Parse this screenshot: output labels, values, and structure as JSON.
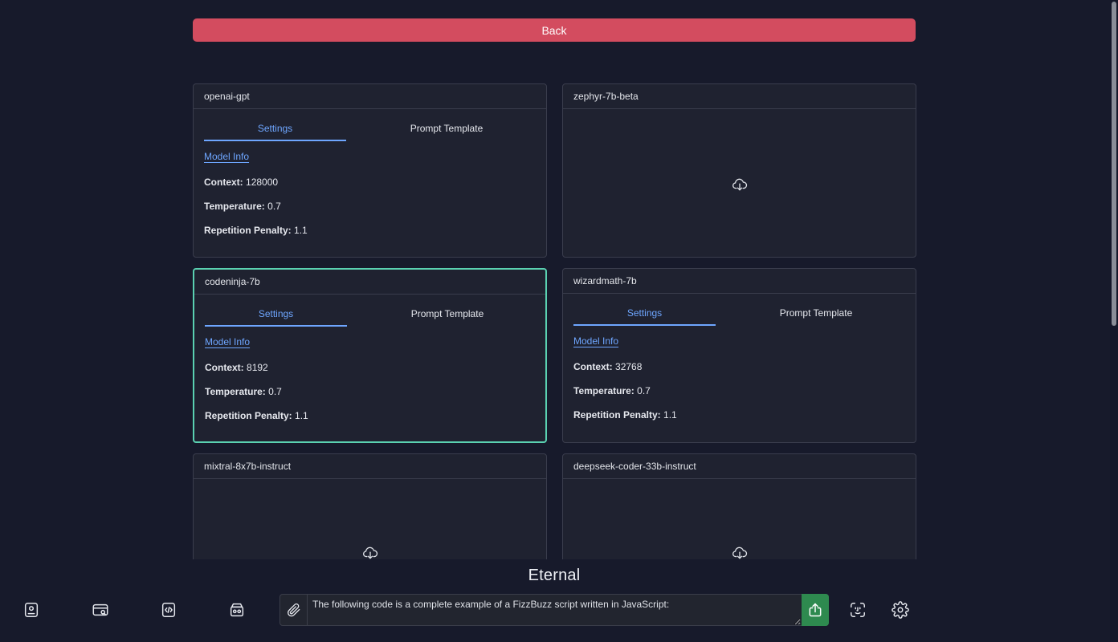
{
  "back_label": "Back",
  "cards": [
    {
      "name": "openai-gpt",
      "settings_tab": "Settings",
      "prompt_tab": "Prompt Template",
      "model_info": "Model Info",
      "context_label": "Context:",
      "context": "128000",
      "temperature_label": "Temperature:",
      "temperature": "0.7",
      "penalty_label": "Repetition Penalty:",
      "penalty": "1.1"
    },
    {
      "name": "zephyr-7b-beta",
      "icon": "cloud-download-icon"
    },
    {
      "name": "codeninja-7b",
      "selected": true,
      "settings_tab": "Settings",
      "prompt_tab": "Prompt Template",
      "model_info": "Model Info",
      "context_label": "Context:",
      "context": "8192",
      "temperature_label": "Temperature:",
      "temperature": "0.7",
      "penalty_label": "Repetition Penalty:",
      "penalty": "1.1"
    },
    {
      "name": "wizardmath-7b",
      "settings_tab": "Settings",
      "prompt_tab": "Prompt Template",
      "model_info": "Model Info",
      "context_label": "Context:",
      "context": "32768",
      "temperature_label": "Temperature:",
      "temperature": "0.7",
      "penalty_label": "Repetition Penalty:",
      "penalty": "1.1"
    },
    {
      "name": "mixtral-8x7b-instruct",
      "icon": "cloud-download-icon"
    },
    {
      "name": "deepseek-coder-33b-instruct",
      "icon": "cloud-download-icon"
    }
  ],
  "footer": {
    "logo_text": "Eternal",
    "composer_text": "The following code is a complete example of a FizzBuzz script written in JavaScript:",
    "left_icons": [
      "contact-card-icon",
      "search-card-icon",
      "code-file-icon",
      "database-icon"
    ],
    "right_icons": [
      "face-scan-icon",
      "gear-icon"
    ],
    "accent": "#2e8a4f"
  },
  "colors": {
    "background": "#171a2b",
    "card": "#1f2230",
    "back_button": "#d34c5f",
    "link": "#6ea6ff",
    "selected_border": "#5ad1b1"
  }
}
